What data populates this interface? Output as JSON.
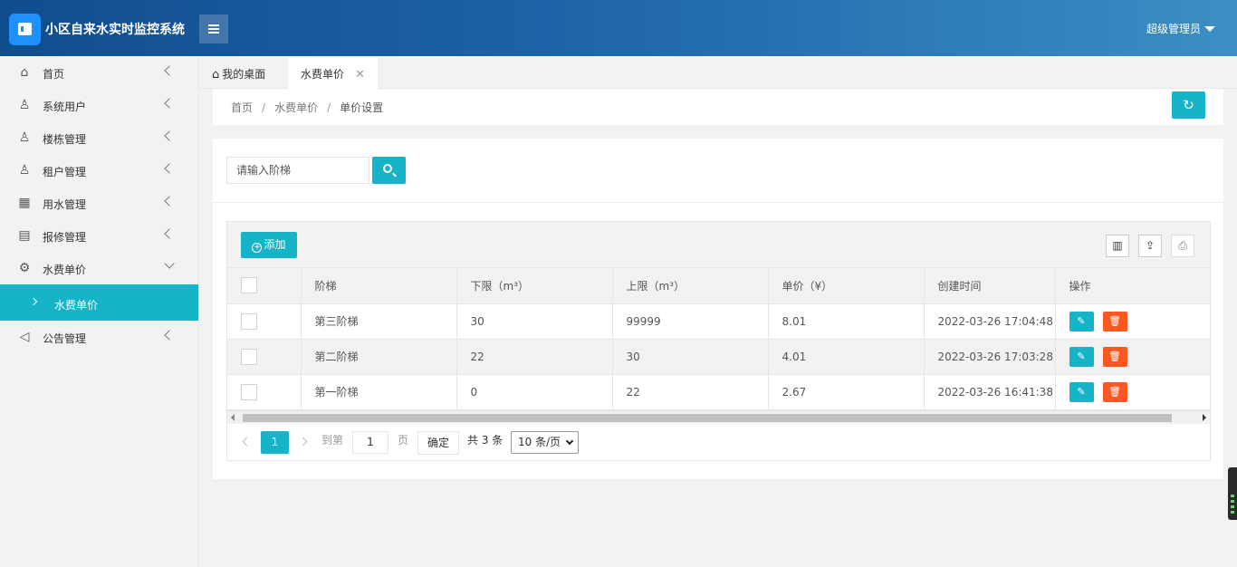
{
  "header": {
    "title": "小区自来水实时监控系统",
    "user": "超级管理员"
  },
  "sidebar": {
    "items": [
      {
        "label": "首页",
        "icon": "home-icon"
      },
      {
        "label": "系统用户",
        "icon": "user-icon"
      },
      {
        "label": "楼栋管理",
        "icon": "user-icon"
      },
      {
        "label": "租户管理",
        "icon": "user-icon"
      },
      {
        "label": "用水管理",
        "icon": "calendar-icon"
      },
      {
        "label": "报修管理",
        "icon": "repair-icon"
      },
      {
        "label": "水费单价",
        "icon": "gear-icon",
        "expanded": true
      },
      {
        "label": "公告管理",
        "icon": "speaker-icon"
      }
    ],
    "sub_item": "水费单价"
  },
  "tabs": [
    {
      "label": "我的桌面"
    },
    {
      "label": "水费单价",
      "active": true
    }
  ],
  "breadcrumb": [
    "首页",
    "水费单价",
    "单价设置"
  ],
  "search": {
    "placeholder": "请输入阶梯"
  },
  "toolbar": {
    "add_label": "添加"
  },
  "table": {
    "columns": [
      "阶梯",
      "下限（m³）",
      "上限（m³）",
      "单价（¥）",
      "创建时间",
      "操作"
    ],
    "rows": [
      [
        "第三阶梯",
        "30",
        "99999",
        "8.01",
        "2022-03-26 17:04:48"
      ],
      [
        "第二阶梯",
        "22",
        "30",
        "4.01",
        "2022-03-26 17:03:28"
      ],
      [
        "第一阶梯",
        "0",
        "22",
        "2.67",
        "2022-03-26 16:41:38"
      ]
    ]
  },
  "pager": {
    "current": "1",
    "goto_label": "到第",
    "goto_value": "1",
    "page_label": "页",
    "ok_label": "确定",
    "total": "共 3 条",
    "page_size": "10 条/页"
  },
  "colors": {
    "accent": "#17b3c8",
    "danger": "#ff5722",
    "header_start": "#104d8d",
    "header_end": "#3b8fc4"
  }
}
